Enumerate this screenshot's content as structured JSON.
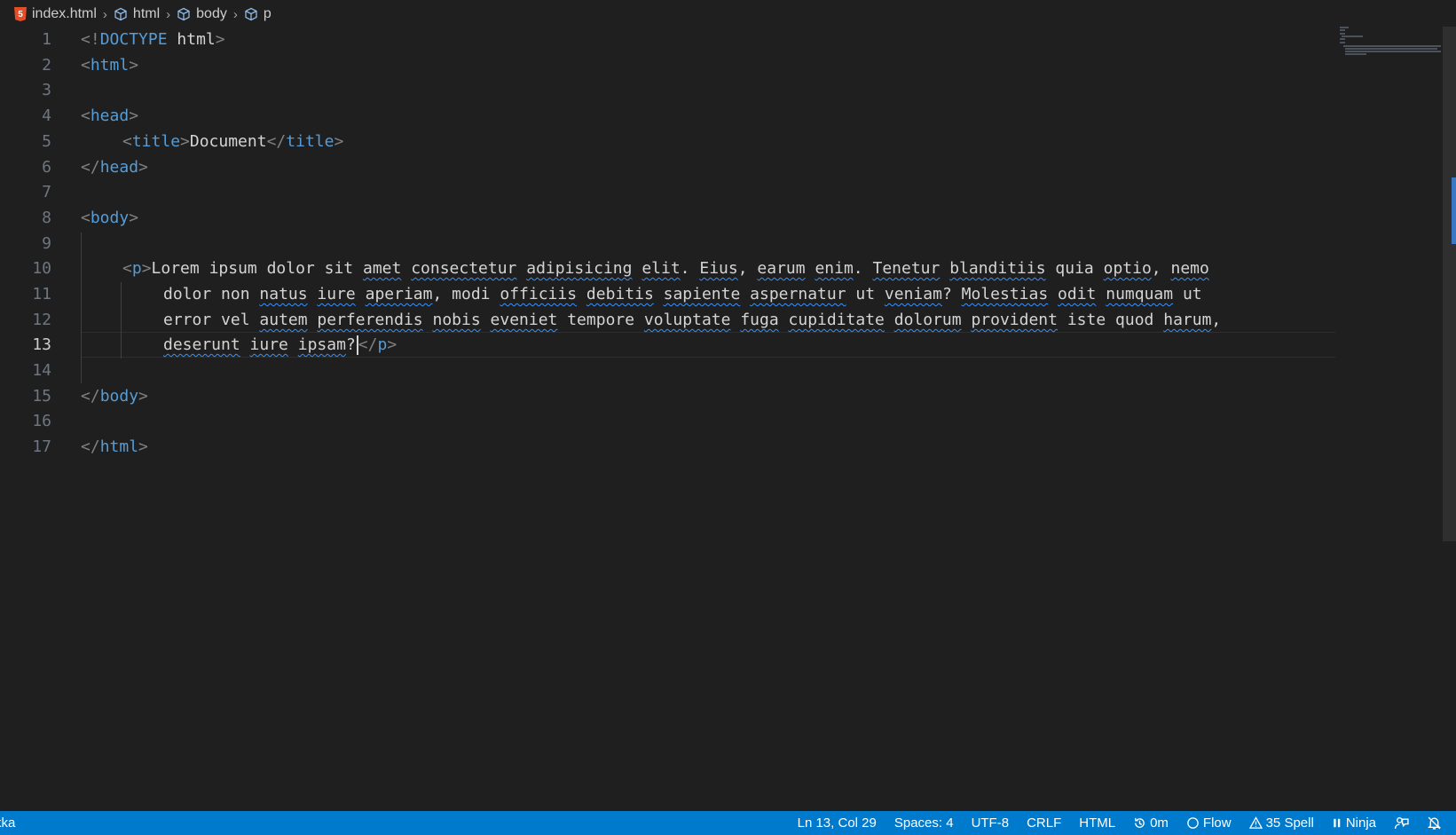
{
  "breadcrumb": {
    "file": "index.html",
    "segments": [
      "html",
      "body",
      "p"
    ],
    "file_icon": "html5-icon",
    "segment_icon": "symbol-cube-icon"
  },
  "editor": {
    "line_numbers": [
      "1",
      "2",
      "3",
      "4",
      "5",
      "6",
      "7",
      "8",
      "9",
      "10",
      "11",
      "12",
      "13",
      "14",
      "15",
      "16",
      "17"
    ],
    "active_line": "13",
    "code": {
      "doctype_open": "<!",
      "doctype_kw": "DOCTYPE",
      "doctype_html": "html",
      "gt": ">",
      "lt": "<",
      "lt_slash": "</",
      "t_html": "html",
      "t_head": "head",
      "t_title": "title",
      "t_body": "body",
      "t_p": "p",
      "title_text": "Document",
      "p_line1": [
        "Lorem",
        " ",
        "ipsum",
        " ",
        "dolor",
        " ",
        "sit",
        " ",
        "amet",
        " ",
        "consectetur",
        " ",
        "adipisicing",
        " ",
        "elit",
        ". ",
        "Eius",
        ", ",
        "earum",
        " ",
        "enim",
        ". ",
        "Tenetur",
        " ",
        "blanditiis",
        " ",
        "quia",
        " ",
        "optio",
        ", ",
        "nemo"
      ],
      "p_line2": [
        "dolor",
        " ",
        "non",
        " ",
        "natus",
        " ",
        "iure",
        " ",
        "aperiam",
        ", ",
        "modi",
        " ",
        "officiis",
        " ",
        "debitis",
        " ",
        "sapiente",
        " ",
        "aspernatur",
        " ",
        "ut",
        " ",
        "veniam",
        "? ",
        "Molestias",
        " ",
        "odit",
        " ",
        "numquam",
        " ",
        "ut"
      ],
      "p_line3": [
        "error",
        " ",
        "vel",
        " ",
        "autem",
        " ",
        "perferendis",
        " ",
        "nobis",
        " ",
        "eveniet",
        " ",
        "tempore",
        " ",
        "voluptate",
        " ",
        "fuga",
        " ",
        "cupiditate",
        " ",
        "dolorum",
        " ",
        "provident",
        " ",
        "iste",
        " ",
        "quod",
        " ",
        "harum",
        ","
      ],
      "p_line4": [
        "deserunt",
        " ",
        "iure",
        " ",
        "ipsam",
        "?"
      ]
    }
  },
  "status_bar": {
    "left_text": "kka",
    "position": "Ln 13, Col 29",
    "spaces": "Spaces: 4",
    "encoding": "UTF-8",
    "eol": "CRLF",
    "language": "HTML",
    "time": "0m",
    "time_icon": "history-icon",
    "flow": "Flow",
    "flow_icon": "circle-icon",
    "spell": "35 Spell",
    "spell_icon": "warning-icon",
    "ninja": "Ninja",
    "ninja_icon": "pause-icon",
    "feedback_icon": "feedback-icon",
    "bell_icon": "bell-slash-icon",
    "accent_color": "#007acc"
  }
}
